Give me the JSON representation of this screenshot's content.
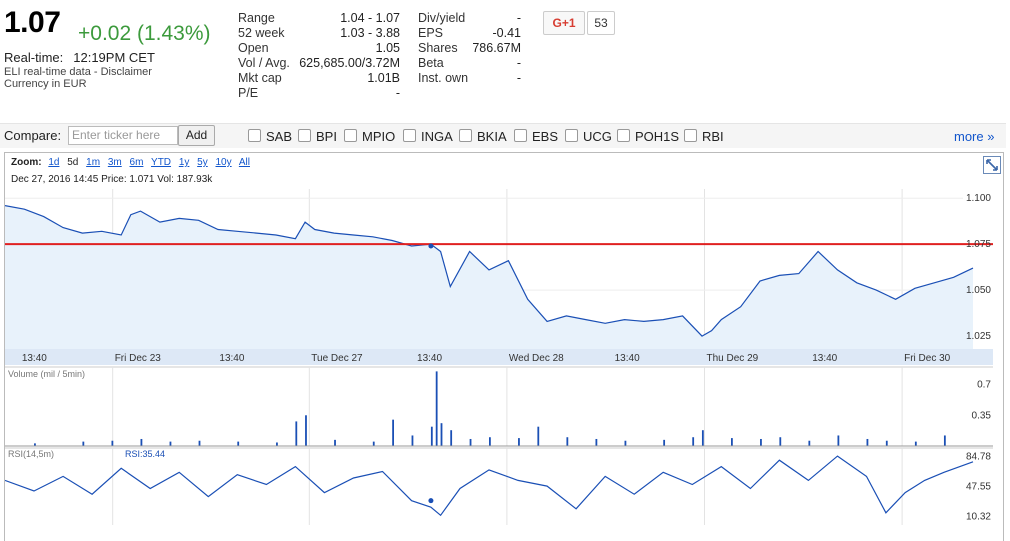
{
  "quote": {
    "price": "1.07",
    "change": "+0.02 (1.43%)",
    "realtime_label": "Real-time:",
    "realtime_time": "12:19PM CET",
    "eli_text": "ELI real-time data - Disclaimer",
    "currency_text": "Currency in EUR"
  },
  "stats_left": [
    {
      "label": "Range",
      "value": "1.04 - 1.07"
    },
    {
      "label": "52 week",
      "value": "1.03 - 3.88"
    },
    {
      "label": "Open",
      "value": "1.05"
    },
    {
      "label": "Vol / Avg.",
      "value": "625,685.00/3.72M"
    },
    {
      "label": "Mkt cap",
      "value": "1.01B"
    },
    {
      "label": "P/E",
      "value": "-"
    }
  ],
  "stats_right": [
    {
      "label": "Div/yield",
      "value": "-"
    },
    {
      "label": "EPS",
      "value": "-0.41"
    },
    {
      "label": "Shares",
      "value": "786.67M"
    },
    {
      "label": "Beta",
      "value": "-"
    },
    {
      "label": "Inst. own",
      "value": "-"
    }
  ],
  "social": {
    "gplus_label": "G+1",
    "count": "53"
  },
  "compare": {
    "label": "Compare:",
    "placeholder": "Enter ticker here",
    "add_label": "Add",
    "tickers": [
      "SAB",
      "BPI",
      "MPIO",
      "INGA",
      "BKIA",
      "EBS",
      "UCG",
      "POH1S",
      "RBI"
    ],
    "more_label": "more »"
  },
  "zoom": {
    "label": "Zoom:",
    "options": [
      "1d",
      "5d",
      "1m",
      "3m",
      "6m",
      "YTD",
      "1y",
      "5y",
      "10y",
      "All"
    ],
    "selected": "5d"
  },
  "hover_info": "Dec 27, 2016 14:45 Price: 1.071 Vol: 187.93k",
  "colors": {
    "price_line": "#1a4fb5",
    "fill": "#e8f2fb",
    "ref_line": "#e02020",
    "change": "#3c9a3c"
  },
  "chart_data": [
    {
      "type": "area",
      "series": [
        {
          "name": "Price",
          "x": [
            0,
            0.02,
            0.04,
            0.06,
            0.08,
            0.1,
            0.12,
            0.13,
            0.14,
            0.16,
            0.18,
            0.2,
            0.22,
            0.24,
            0.26,
            0.28,
            0.3,
            0.31,
            0.32,
            0.34,
            0.36,
            0.38,
            0.4,
            0.42,
            0.44,
            0.45,
            0.46,
            0.48,
            0.5,
            0.52,
            0.54,
            0.56,
            0.58,
            0.6,
            0.62,
            0.64,
            0.66,
            0.68,
            0.7,
            0.72,
            0.73,
            0.74,
            0.76,
            0.78,
            0.8,
            0.82,
            0.84,
            0.86,
            0.88,
            0.9,
            0.92,
            0.94,
            0.96,
            0.98,
            1.0
          ],
          "y": [
            1.096,
            1.094,
            1.09,
            1.084,
            1.081,
            1.082,
            1.08,
            1.091,
            1.093,
            1.087,
            1.089,
            1.088,
            1.083,
            1.082,
            1.081,
            1.08,
            1.078,
            1.087,
            1.083,
            1.081,
            1.08,
            1.079,
            1.077,
            1.074,
            1.075,
            1.071,
            1.052,
            1.071,
            1.061,
            1.066,
            1.045,
            1.033,
            1.036,
            1.034,
            1.032,
            1.034,
            1.033,
            1.034,
            1.036,
            1.025,
            1.028,
            1.034,
            1.041,
            1.055,
            1.058,
            1.059,
            1.071,
            1.061,
            1.054,
            1.05,
            1.045,
            1.051,
            1.054,
            1.057,
            1.062
          ]
        }
      ],
      "x_ticks": [
        "13:40",
        "Fri Dec 23",
        "13:40",
        "Tue Dec 27",
        "13:40",
        "Wed Dec 28",
        "13:40",
        "Thu Dec 29",
        "13:40",
        "Fri Dec 30"
      ],
      "y_ticks": [
        "1.100",
        "1.075",
        "1.050",
        "1.025"
      ],
      "ylim": [
        1.018,
        1.105
      ],
      "reference_line": 1.075
    },
    {
      "type": "bar",
      "title": "Volume (mil / 5min)",
      "y_ticks": [
        "0.7",
        "0.35"
      ],
      "ylim": [
        0,
        0.9
      ],
      "series": [
        {
          "name": "Volume",
          "x": [
            0.03,
            0.08,
            0.11,
            0.14,
            0.17,
            0.2,
            0.24,
            0.28,
            0.3,
            0.31,
            0.34,
            0.38,
            0.4,
            0.42,
            0.44,
            0.445,
            0.45,
            0.46,
            0.48,
            0.5,
            0.53,
            0.55,
            0.58,
            0.61,
            0.64,
            0.68,
            0.71,
            0.72,
            0.75,
            0.78,
            0.8,
            0.83,
            0.86,
            0.89,
            0.91,
            0.94,
            0.97
          ],
          "values": [
            0.03,
            0.05,
            0.06,
            0.08,
            0.05,
            0.06,
            0.05,
            0.04,
            0.28,
            0.35,
            0.07,
            0.05,
            0.3,
            0.12,
            0.22,
            0.85,
            0.26,
            0.18,
            0.08,
            0.1,
            0.09,
            0.22,
            0.1,
            0.08,
            0.06,
            0.07,
            0.1,
            0.18,
            0.09,
            0.08,
            0.1,
            0.06,
            0.12,
            0.08,
            0.06,
            0.05,
            0.12
          ]
        }
      ]
    },
    {
      "type": "line",
      "title": "RSI(14,5m)",
      "value_label": "RSI:35.44",
      "y_ticks": [
        "84.78",
        "47.55",
        "10.32"
      ],
      "ylim": [
        0,
        95
      ],
      "series": [
        {
          "name": "RSI",
          "x": [
            0,
            0.03,
            0.06,
            0.09,
            0.12,
            0.15,
            0.18,
            0.21,
            0.24,
            0.27,
            0.3,
            0.33,
            0.36,
            0.39,
            0.42,
            0.44,
            0.45,
            0.47,
            0.5,
            0.53,
            0.56,
            0.59,
            0.62,
            0.65,
            0.68,
            0.71,
            0.74,
            0.77,
            0.8,
            0.83,
            0.86,
            0.89,
            0.91,
            0.93,
            0.95,
            0.97,
            1.0
          ],
          "values": [
            55,
            42,
            60,
            38,
            70,
            45,
            65,
            35,
            62,
            50,
            72,
            40,
            58,
            66,
            30,
            22,
            12,
            45,
            68,
            55,
            48,
            20,
            60,
            38,
            65,
            50,
            72,
            45,
            80,
            55,
            85,
            60,
            15,
            40,
            55,
            65,
            78
          ]
        }
      ]
    }
  ]
}
